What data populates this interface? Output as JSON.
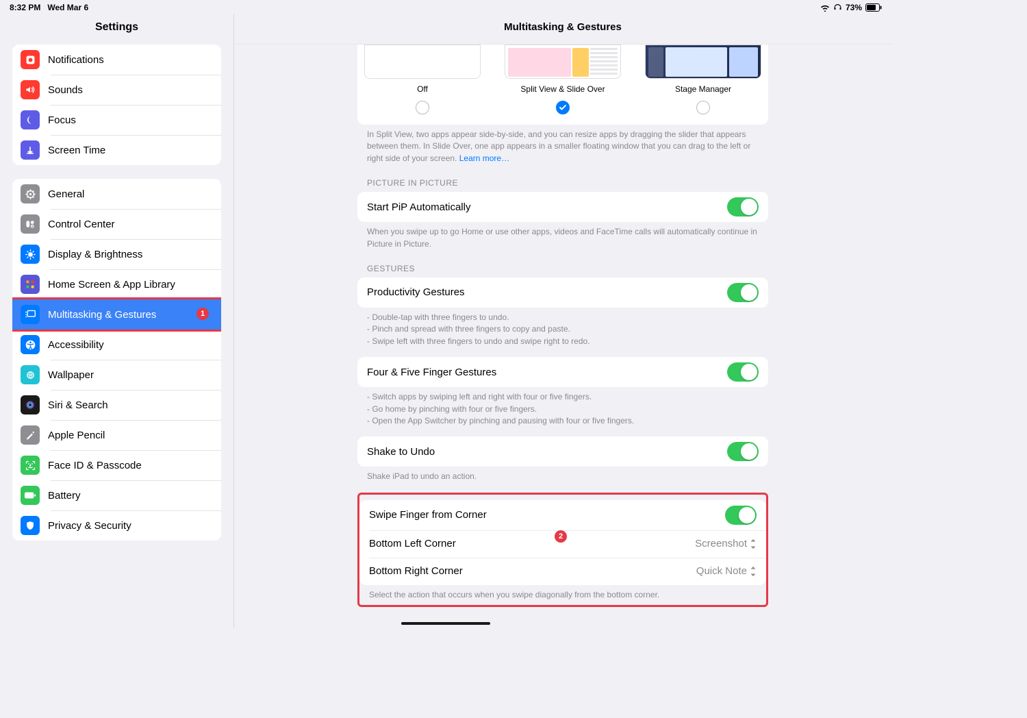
{
  "status": {
    "time": "8:32 PM",
    "date": "Wed Mar 6",
    "battery_pct": "73%"
  },
  "sidebar": {
    "title": "Settings",
    "groups": [
      [
        {
          "label": "Notifications",
          "icon": "notifications",
          "color": "#ff3a30"
        },
        {
          "label": "Sounds",
          "icon": "sounds",
          "color": "#ff3a30"
        },
        {
          "label": "Focus",
          "icon": "focus",
          "color": "#5e5ce6"
        },
        {
          "label": "Screen Time",
          "icon": "screentime",
          "color": "#5e5ce6"
        }
      ],
      [
        {
          "label": "General",
          "icon": "general",
          "color": "#8e8e93"
        },
        {
          "label": "Control Center",
          "icon": "controlcenter",
          "color": "#8e8e93"
        },
        {
          "label": "Display & Brightness",
          "icon": "display",
          "color": "#007aff"
        },
        {
          "label": "Home Screen & App Library",
          "icon": "homescreen",
          "color": "#5856d6"
        },
        {
          "label": "Multitasking & Gestures",
          "icon": "multitasking",
          "color": "#007aff",
          "selected": true,
          "highlighted": true,
          "badge": "1"
        },
        {
          "label": "Accessibility",
          "icon": "accessibility",
          "color": "#007aff"
        },
        {
          "label": "Wallpaper",
          "icon": "wallpaper",
          "color": "#20c2d6"
        },
        {
          "label": "Siri & Search",
          "icon": "siri",
          "color": "#1a1a1a"
        },
        {
          "label": "Apple Pencil",
          "icon": "pencil",
          "color": "#8e8e93"
        },
        {
          "label": "Face ID & Passcode",
          "icon": "faceid",
          "color": "#34c759"
        },
        {
          "label": "Battery",
          "icon": "battery",
          "color": "#34c759"
        },
        {
          "label": "Privacy & Security",
          "icon": "privacy",
          "color": "#007aff"
        }
      ]
    ]
  },
  "content": {
    "title": "Multitasking & Gestures",
    "modes": [
      {
        "label": "Off",
        "checked": false
      },
      {
        "label": "Split View & Slide Over",
        "checked": true
      },
      {
        "label": "Stage Manager",
        "checked": false
      }
    ],
    "mode_desc": "In Split View, two apps appear side-by-side, and you can resize apps by dragging the slider that appears between them. In Slide Over, one app appears in a smaller floating window that you can drag to the left or right side of your screen. ",
    "learn_more": "Learn more…",
    "pip": {
      "header": "PICTURE IN PICTURE",
      "row": "Start PiP Automatically",
      "desc": "When you swipe up to go Home or use other apps, videos and FaceTime calls will automatically continue in Picture in Picture."
    },
    "gestures": {
      "header": "GESTURES",
      "prod": {
        "label": "Productivity Gestures",
        "b1": "- Double-tap with three fingers to undo.",
        "b2": "- Pinch and spread with three fingers to copy and paste.",
        "b3": "- Swipe left with three fingers to undo and swipe right to redo."
      },
      "ff": {
        "label": "Four & Five Finger Gestures",
        "b1": "- Switch apps by swiping left and right with four or five fingers.",
        "b2": "- Go home by pinching with four or five fingers.",
        "b3": "- Open the App Switcher by pinching and pausing with four or five fingers."
      },
      "shake": {
        "label": "Shake to Undo",
        "desc": "Shake iPad to undo an action."
      }
    },
    "corner": {
      "swipe": "Swipe Finger from Corner",
      "bl_label": "Bottom Left Corner",
      "bl_value": "Screenshot",
      "br_label": "Bottom Right Corner",
      "br_value": "Quick Note",
      "desc": "Select the action that occurs when you swipe diagonally from the bottom corner.",
      "badge": "2"
    }
  }
}
